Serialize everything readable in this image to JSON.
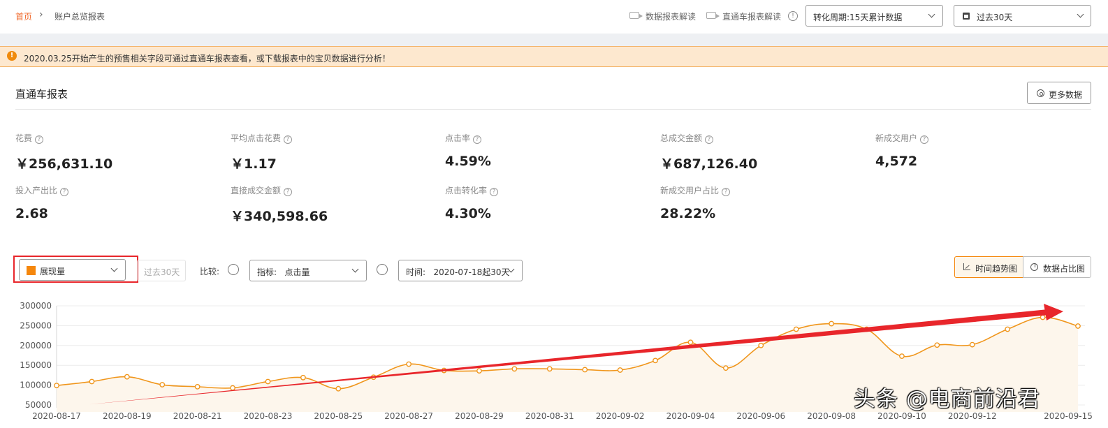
{
  "breadcrumb": {
    "home": "首页",
    "separator": "›",
    "current": "账户总览报表"
  },
  "header": {
    "link_data_report": "数据报表解读",
    "link_ztc_report": "直通车报表解读",
    "info_symbol": "!",
    "conversion_select": "转化周期:15天累计数据",
    "date_select": "过去30天"
  },
  "notice": {
    "icon": "!",
    "text": "2020.03.25开始产生的预售相关字段可通过直通车报表查看，或下载报表中的宝贝数据进行分析！"
  },
  "section": {
    "title": "直通车报表",
    "more_button": "更多数据"
  },
  "metrics": [
    {
      "label": "花费",
      "value": "￥256,631.10"
    },
    {
      "label": "平均点击花费",
      "value": "￥1.17"
    },
    {
      "label": "点击率",
      "value": "4.59%"
    },
    {
      "label": "总成交金额",
      "value": "￥687,126.40"
    },
    {
      "label": "新成交用户",
      "value": "4,572"
    },
    {
      "label": "投入产出比",
      "value": "2.68"
    },
    {
      "label": "直接成交金额",
      "value": "￥340,598.66"
    },
    {
      "label": "点击转化率",
      "value": "4.30%"
    },
    {
      "label": "新成交用户占比",
      "value": "28.22%"
    }
  ],
  "help_symbol": "?",
  "controls": {
    "metric_select": "展现量",
    "period_disabled": "过去30天",
    "compare_label": "比较:",
    "indicator_select": "指标:   点击量",
    "time_select": "时间:   2020-07-18起30天",
    "tab_trend": "时间趋势图",
    "tab_share": "数据占比图"
  },
  "colors": {
    "accent": "#f5870c",
    "line": "#f0961c",
    "arrow": "#e8262b",
    "notice_bg": "#fde8cf"
  },
  "chart_data": {
    "type": "line",
    "series": [
      {
        "values": [
          99000,
          109000,
          121000,
          101000,
          96000,
          93000,
          109000,
          119000,
          91000,
          120000,
          153000,
          137000,
          136000,
          141000,
          141000,
          139000,
          138000,
          162000,
          208000,
          143000,
          200000,
          241000,
          255000,
          241000,
          173000,
          201000,
          202000,
          241000,
          271000,
          249000
        ]
      }
    ],
    "x_labels": [
      "2020-08-17",
      "2020-08-19",
      "2020-08-21",
      "2020-08-23",
      "2020-08-25",
      "2020-08-27",
      "2020-08-29",
      "2020-08-31",
      "2020-09-02",
      "2020-09-04",
      "2020-09-06",
      "2020-09-08",
      "2020-09-10",
      "2020-09-12",
      "2020-09-15"
    ],
    "y_ticks": [
      300000,
      250000,
      200000,
      150000,
      100000,
      50000
    ],
    "ylim": [
      50000,
      300000
    ],
    "grid": true,
    "annotation": "red trend arrow"
  },
  "watermark": "头条 @电商前沿君"
}
